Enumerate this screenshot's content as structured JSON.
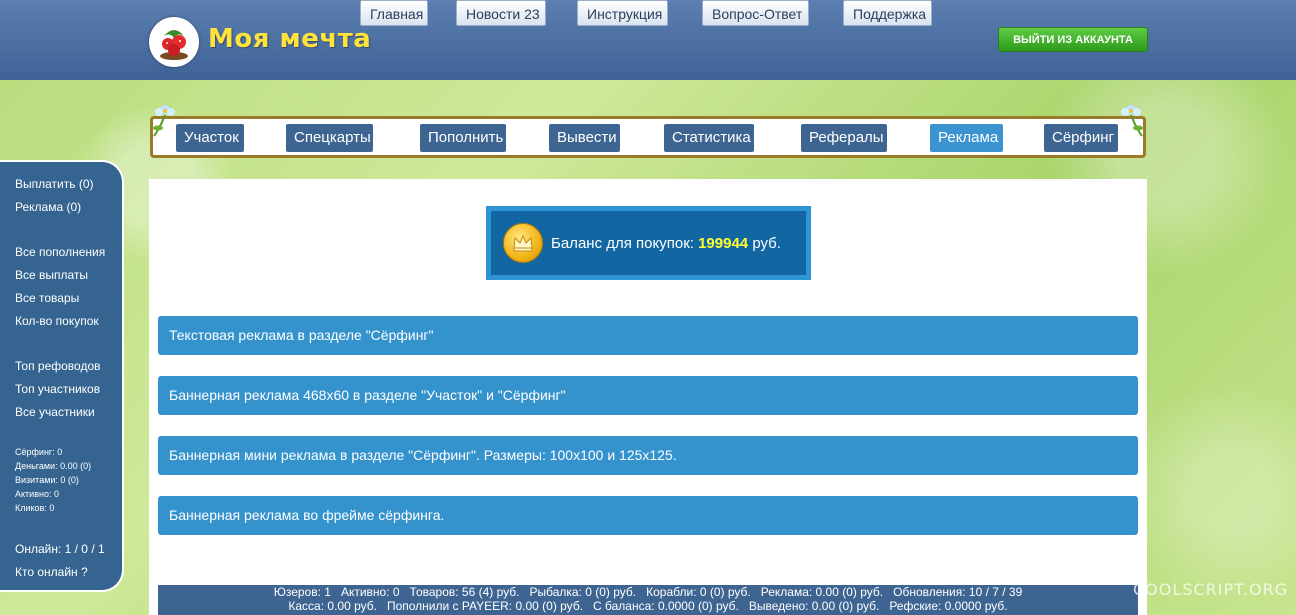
{
  "header": {
    "logo_text": "Моя мечта",
    "nav": [
      "Главная",
      "Новости 23",
      "Инструкция",
      "Вопрос-Ответ",
      "Поддержка"
    ],
    "logout_label": "ВЫЙТИ ИЗ АККАУНТА"
  },
  "menu": {
    "items": [
      "Участок",
      "Спецкарты",
      "Пополнить",
      "Вывести",
      "Статистика",
      "Рефералы",
      "Реклама",
      "Сёрфинг"
    ],
    "active": "Реклама"
  },
  "sidebar": {
    "links_top": [
      "Выплатить (0)",
      "Реклама (0)"
    ],
    "links_mid": [
      "Все пополнения",
      "Все выплаты",
      "Все товары",
      "Кол-во покупок"
    ],
    "links_low": [
      "Топ рефоводов",
      "Топ участников",
      "Все участники"
    ],
    "stats": [
      "Сёрфинг: 0",
      "Деньгами: 0.00 (0)",
      "Визитами: 0 (0)",
      "Активно: 0",
      "Кликов: 0"
    ],
    "online": "Онлайн: 1 / 0 / 1",
    "who_online": "Кто онлайн ?"
  },
  "balance": {
    "label": "Баланс для покупок:",
    "value": "199944",
    "currency": "руб."
  },
  "ads": [
    "Текстовая реклама в разделе \"Сёрфинг\"",
    "Баннерная реклама 468x60 в разделе \"Участок\" и \"Сёрфинг\"",
    "Баннерная мини реклама в разделе \"Сёрфинг\". Размеры: 100x100 и 125x125.",
    "Баннерная реклама во фрейме сёрфинга."
  ],
  "footer": {
    "line1": "Юзеров: 1   Активно: 0   Товаров: 56 (4) руб.   Рыбалка: 0 (0) руб.   Корабли: 0 (0) руб.   Реклама: 0.00 (0) руб.   Обновления: 10 / 7 / 39",
    "line2": "Касса: 0.00 руб.   Пополнили с PAYEER: 0.00 (0) руб.   С баланса: 0.0000 (0) руб.   Выведено: 0.00 (0) руб.   Рефские: 0.0000 руб."
  },
  "watermark": "COOLSCRIPT.ORG",
  "colors": {
    "header_bg": "#4a6ea3",
    "menu_btn": "#3e6592",
    "menu_active": "#3b93d0",
    "ad_row": "#3492cc",
    "balance_value": "#ffff33",
    "logout_green": "#3fae2a",
    "logo_yellow": "#ffe33a"
  },
  "icons": {
    "logo": "strawberry-icon",
    "coin": "crown-coin-icon"
  }
}
